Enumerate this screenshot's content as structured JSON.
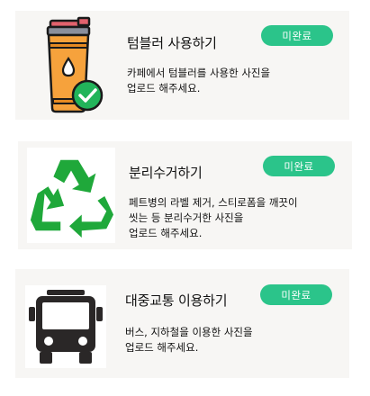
{
  "missions": [
    {
      "title": "텀블러 사용하기",
      "status": "미완료",
      "description": "카페에서 텀블러를 사용한 사진을\n업로드 해주세요.",
      "icon": "tumbler-check-icon"
    },
    {
      "title": "분리수거하기",
      "status": "미완료",
      "description": "페트병의 라벨 제거, 스티로폼을 깨끗이\n씻는 등 분리수거한 사진을\n업로드 해주세요.",
      "icon": "recycle-icon"
    },
    {
      "title": "대중교통 이용하기",
      "status": "미완료",
      "description": "버스, 지하철을 이용한 사진을\n업로드 해주세요.",
      "icon": "bus-icon"
    }
  ],
  "colors": {
    "card_bg": "#f7f6f4",
    "badge_bg": "#2bc48a",
    "recycle_green": "#1fa83a",
    "tumbler_orange": "#f6a23c",
    "check_green": "#22b45a",
    "bus_dark": "#2a2727"
  }
}
